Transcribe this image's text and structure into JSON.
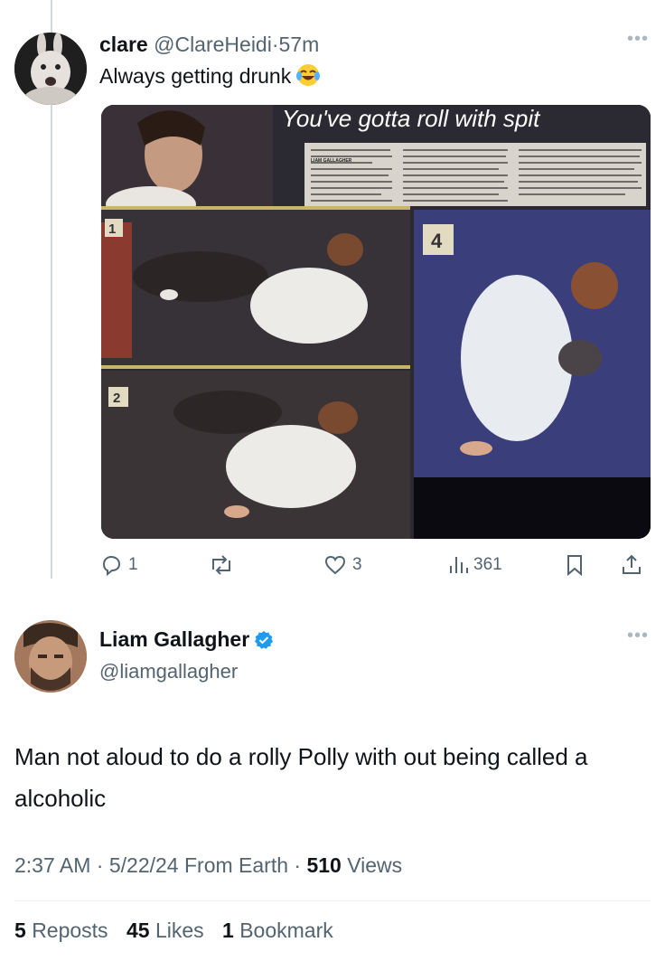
{
  "tweet1": {
    "display_name": "clare",
    "handle": "@ClareHeidi",
    "separator": "·",
    "time": "57m",
    "text": "Always getting drunk",
    "emoji": "laughing-tears-emoji",
    "media": {
      "headline": "You've gotta roll with spit",
      "panel_labels": [
        "1",
        "2",
        "4"
      ],
      "clipping_header": "LIAM GALLAGHER"
    },
    "actions": {
      "replies": "1",
      "reposts": "",
      "likes": "3",
      "views": "361"
    }
  },
  "tweet2": {
    "display_name": "Liam Gallagher",
    "handle": "@liamgallagher",
    "text": "Man not aloud to do a rolly Polly with out being called a alcoholic",
    "time": "2:37 AM",
    "dot": "·",
    "date": "5/22/24",
    "source": "From Earth",
    "views_count": "510",
    "views_label": "Views",
    "reposts_count": "5",
    "reposts_label": "Reposts",
    "likes_count": "45",
    "likes_label": "Likes",
    "bookmarks_count": "1",
    "bookmarks_label": "Bookmark"
  },
  "colors": {
    "muted": "#536471",
    "verified": "#1d9bf0",
    "text": "#0f1419"
  }
}
